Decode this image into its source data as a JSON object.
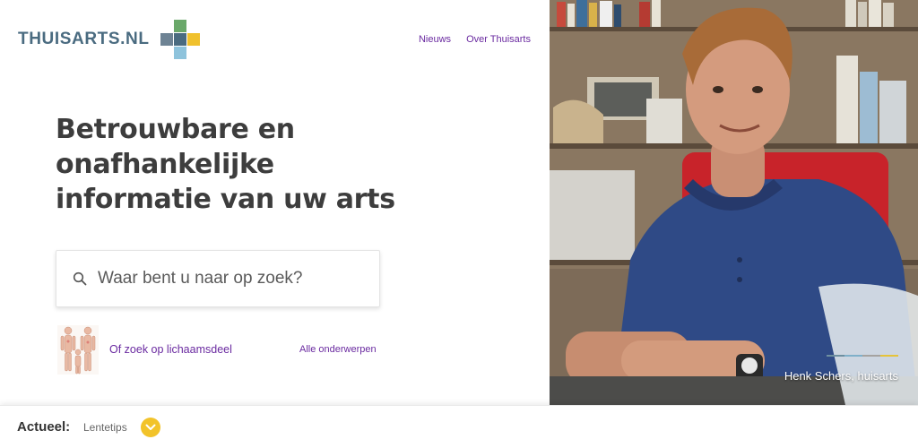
{
  "brand": {
    "name": "THUISARTS.NL",
    "colors": {
      "slate": "#4a6b80",
      "green": "#6aa86a",
      "yellow": "#f0c12d",
      "lightblue": "#8ec3dc",
      "greyblue": "#6e8394"
    }
  },
  "nav": {
    "items": [
      "Nieuws",
      "Over Thuisarts"
    ]
  },
  "hero": {
    "headline": "Betrouwbare en onafhankelijke informatie van uw arts",
    "caption": "Henk Schers, huisarts"
  },
  "search": {
    "placeholder": "Waar bent u naar op zoek?",
    "icon": "search-icon"
  },
  "links": {
    "bodypart": "Of zoek op lichaamsdeel",
    "all_topics": "Alle onderwerpen"
  },
  "actueel": {
    "label": "Actueel:",
    "item": "Lentetips",
    "toggle_icon": "chevron-down-icon"
  },
  "colors": {
    "link": "#6a2aa0",
    "accent_yellow": "#f2c32a",
    "heading": "#3d3d3d"
  }
}
